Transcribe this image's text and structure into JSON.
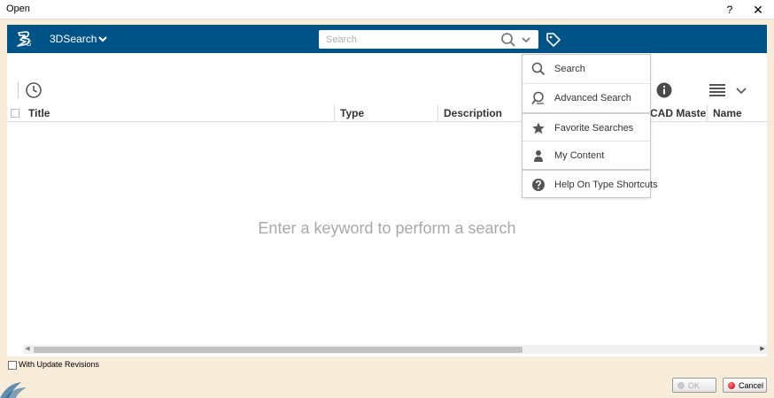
{
  "window": {
    "title": "Open",
    "help": "?",
    "close": "✕"
  },
  "topbar": {
    "app_name": "3DSearch",
    "search_placeholder": "Search",
    "bg_color": "#005386"
  },
  "toolbar": {
    "icons": [
      "clock-icon",
      "info-icon",
      "list-view-icon",
      "chevron-down-icon"
    ]
  },
  "grid": {
    "columns": [
      "Title",
      "Type",
      "Description",
      "CAD Master",
      "Name"
    ],
    "empty_message": "Enter a keyword to perform a search"
  },
  "search_menu": {
    "items": [
      {
        "label": "Search",
        "icon": "search-icon"
      },
      {
        "label": "Advanced Search",
        "icon": "advanced-search-icon"
      },
      {
        "label": "Favorite Searches",
        "icon": "star-icon"
      },
      {
        "label": "My Content",
        "icon": "user-icon"
      },
      {
        "label": "Help On Type Shortcuts",
        "icon": "help-icon"
      }
    ]
  },
  "footer": {
    "with_update_revisions": "With Update Revisions",
    "ok_label": "OK",
    "cancel_label": "Cancel"
  }
}
